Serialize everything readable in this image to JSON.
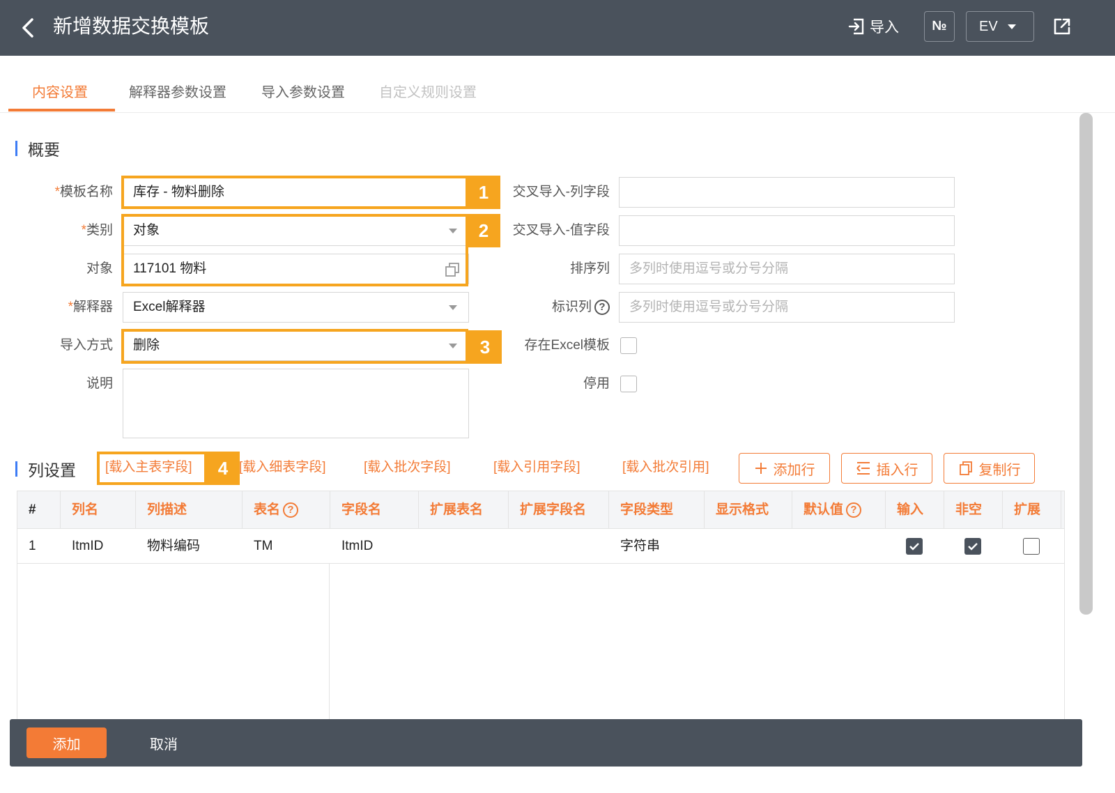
{
  "header": {
    "title": "新增数据交换模板",
    "import_label": "导入",
    "no_label": "№",
    "lang_label": "EV"
  },
  "tabs": [
    {
      "label": "内容设置",
      "state": "active"
    },
    {
      "label": "解释器参数设置",
      "state": "normal"
    },
    {
      "label": "导入参数设置",
      "state": "normal"
    },
    {
      "label": "自定义规则设置",
      "state": "disabled"
    }
  ],
  "overview": {
    "title": "概要",
    "template_name": {
      "required": "*",
      "label": "模板名称",
      "value": "库存 - 物料删除"
    },
    "category": {
      "required": "*",
      "label": "类别",
      "value": "对象"
    },
    "object": {
      "label": "对象",
      "value": "117101 物料"
    },
    "parser": {
      "required": "*",
      "label": "解释器",
      "value": "Excel解释器"
    },
    "import_mode": {
      "label": "导入方式",
      "value": "删除"
    },
    "description": {
      "label": "说明",
      "value": ""
    },
    "cross_col": {
      "label": "交叉导入-列字段",
      "value": ""
    },
    "cross_val": {
      "label": "交叉导入-值字段",
      "value": ""
    },
    "sort_col": {
      "label": "排序列",
      "placeholder": "多列时使用逗号或分号分隔"
    },
    "id_col": {
      "label": "标识列",
      "placeholder": "多列时使用逗号或分号分隔"
    },
    "excel_template": {
      "label": "存在Excel模板",
      "checked": false
    },
    "disabled": {
      "label": "停用",
      "checked": false
    }
  },
  "callouts": [
    "1",
    "2",
    "3",
    "4"
  ],
  "columns_section": {
    "title": "列设置",
    "load_links": [
      "[载入主表字段]",
      "[载入细表字段]",
      "[载入批次字段]",
      "[载入引用字段]",
      "[载入批次引用]"
    ],
    "add_row": "添加行",
    "insert_row": "插入行",
    "copy_row": "复制行"
  },
  "table": {
    "headers": [
      "#",
      "列名",
      "列描述",
      "表名",
      "字段名",
      "扩展表名",
      "扩展字段名",
      "字段类型",
      "显示格式",
      "默认值",
      "输入",
      "非空",
      "扩展"
    ],
    "rows": [
      {
        "num": "1",
        "col_name": "ItmID",
        "col_desc": "物料编码",
        "table_name": "TM",
        "field_name": "ItmID",
        "ext_table": "",
        "ext_field": "",
        "field_type": "字符串",
        "display_format": "",
        "default_value": "",
        "input": true,
        "not_null": true,
        "extend": false
      }
    ]
  },
  "footer": {
    "add_label": "添加",
    "cancel_label": "取消"
  },
  "colors": {
    "header_bg": "#4a525c",
    "accent": "#f37b36",
    "callout": "#f6a51f",
    "section_bar": "#3d7cf5"
  }
}
